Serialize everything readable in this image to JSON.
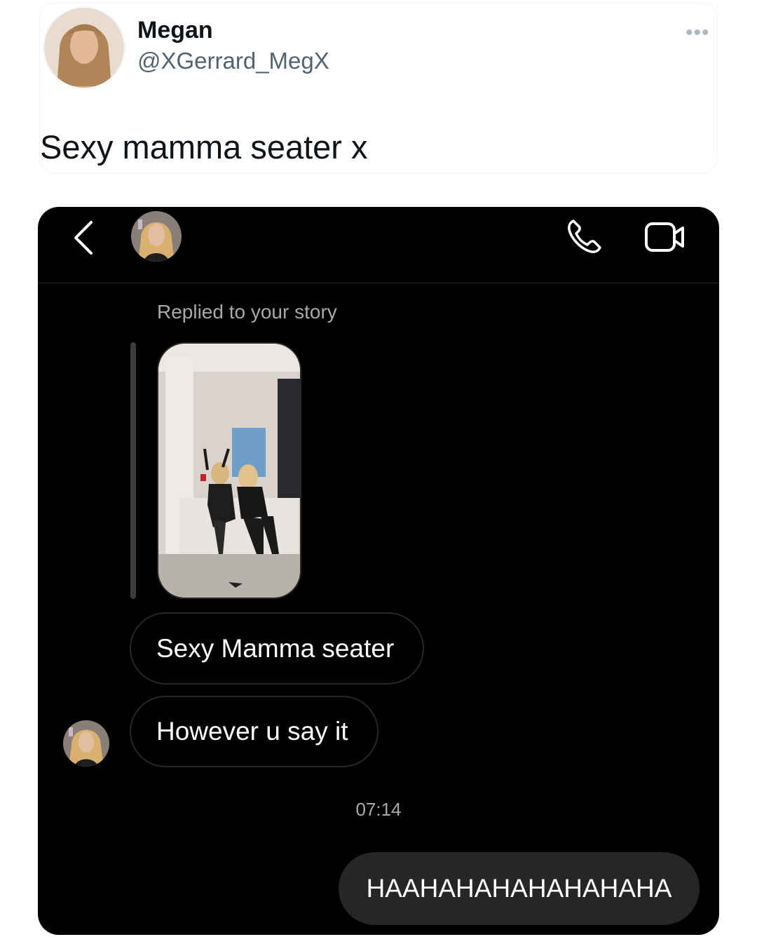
{
  "tweet": {
    "display_name": "Megan",
    "handle": "@XGerrard_MegX",
    "text": "Sexy mamma seater x",
    "more_icon": "more-horizontal-icon"
  },
  "dm": {
    "header": {
      "back_icon": "chevron-left-icon",
      "call_icon": "phone-icon",
      "video_icon": "video-camera-icon"
    },
    "story_reply_label": "Replied to your story",
    "messages": [
      {
        "from": "them",
        "text": "Sexy Mamma seater"
      },
      {
        "from": "them",
        "text": "However u say it"
      }
    ],
    "timestamp": "07:14",
    "sent_message": "HAAHAHAHAHAHAHAHA"
  },
  "colors": {
    "dm_background": "#000000",
    "received_border": "#262626",
    "sent_bubble": "#262626",
    "meta_text": "#a8a8a8",
    "handle_text": "#536471"
  }
}
